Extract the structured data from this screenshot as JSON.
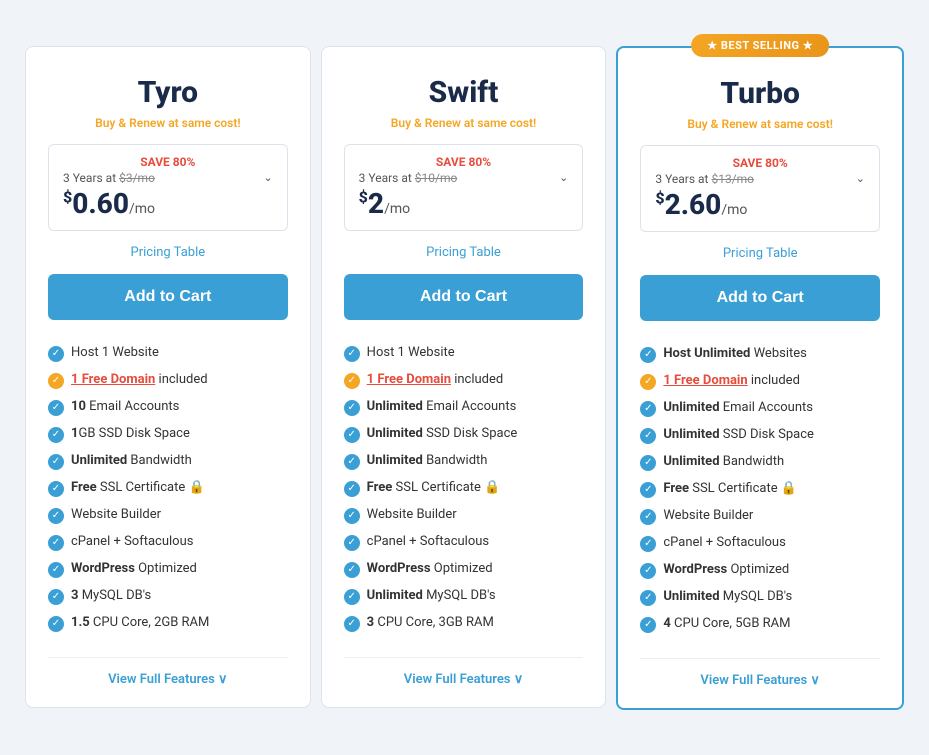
{
  "plans": [
    {
      "id": "tyro",
      "name": "Tyro",
      "tagline": "Buy & Renew at same cost!",
      "featured": false,
      "save_label": "SAVE 80%",
      "years_text": "3 Years at",
      "original_price": "$3/mo",
      "current_price_symbol": "$",
      "current_price_main": "0.60",
      "current_price_suffix": "/mo",
      "pricing_table_label": "Pricing Table",
      "add_to_cart_label": "Add to Cart",
      "features": [
        {
          "icon": "blue",
          "text": "Host 1 Website",
          "bold": ""
        },
        {
          "icon": "orange",
          "text": " Free Domain included",
          "bold": "1",
          "red_link": "1 Free Domain"
        },
        {
          "icon": "blue",
          "text": " Email Accounts",
          "bold": "10",
          "prefix_bold": "10"
        },
        {
          "icon": "blue",
          "text": "GB SSD Disk Space",
          "bold": "1",
          "prefix_bold": "1"
        },
        {
          "icon": "blue",
          "text": " Bandwidth",
          "bold": "Unlimited",
          "prefix_bold": "Unlimited"
        },
        {
          "icon": "blue",
          "text": " SSL Certificate 🔒",
          "bold": "Free",
          "prefix_bold": "Free",
          "ssl": true
        },
        {
          "icon": "blue",
          "text": "Website Builder",
          "bold": ""
        },
        {
          "icon": "blue",
          "text": "cPanel + Softaculous",
          "bold": ""
        },
        {
          "icon": "blue",
          "text": " Optimized",
          "bold": "WordPress",
          "prefix_bold": "WordPress"
        },
        {
          "icon": "blue",
          "text": " MySQL DB's",
          "bold": "3",
          "prefix_bold": "3"
        },
        {
          "icon": "blue",
          "text": " CPU Core, 2GB RAM",
          "bold": "1.5",
          "prefix_bold": "1.5"
        }
      ],
      "view_full_features_label": "View Full Features ∨"
    },
    {
      "id": "swift",
      "name": "Swift",
      "tagline": "Buy & Renew at same cost!",
      "featured": false,
      "save_label": "SAVE 80%",
      "years_text": "3 Years at",
      "original_price": "$10/mo",
      "current_price_symbol": "$",
      "current_price_main": "2",
      "current_price_suffix": "/mo",
      "pricing_table_label": "Pricing Table",
      "add_to_cart_label": "Add to Cart",
      "features": [
        {
          "icon": "blue",
          "text": "Host 1 Website",
          "bold": ""
        },
        {
          "icon": "orange",
          "text": " Free Domain included",
          "bold": "1",
          "red_link": "1 Free Domain"
        },
        {
          "icon": "blue",
          "text": " Email Accounts",
          "bold": "Unlimited",
          "prefix_bold": "Unlimited"
        },
        {
          "icon": "blue",
          "text": " SSD Disk Space",
          "bold": "Unlimited",
          "prefix_bold": "Unlimited"
        },
        {
          "icon": "blue",
          "text": " Bandwidth",
          "bold": "Unlimited",
          "prefix_bold": "Unlimited"
        },
        {
          "icon": "blue",
          "text": " SSL Certificate 🔒",
          "bold": "Free",
          "prefix_bold": "Free",
          "ssl": true
        },
        {
          "icon": "blue",
          "text": "Website Builder",
          "bold": ""
        },
        {
          "icon": "blue",
          "text": "cPanel + Softaculous",
          "bold": ""
        },
        {
          "icon": "blue",
          "text": " Optimized",
          "bold": "WordPress",
          "prefix_bold": "WordPress"
        },
        {
          "icon": "blue",
          "text": " MySQL DB's",
          "bold": "Unlimited",
          "prefix_bold": "Unlimited"
        },
        {
          "icon": "blue",
          "text": " CPU Core, 3GB RAM",
          "bold": "3",
          "prefix_bold": "3"
        }
      ],
      "view_full_features_label": "View Full Features ∨"
    },
    {
      "id": "turbo",
      "name": "Turbo",
      "tagline": "Buy & Renew at same cost!",
      "featured": true,
      "best_selling_label": "★ BEST SELLING ★",
      "save_label": "SAVE 80%",
      "years_text": "3 Years at",
      "original_price": "$13/mo",
      "current_price_symbol": "$",
      "current_price_main": "2.60",
      "current_price_suffix": "/mo",
      "pricing_table_label": "Pricing Table",
      "add_to_cart_label": "Add to Cart",
      "features": [
        {
          "icon": "blue",
          "text": " Websites",
          "bold": "Host Unlimited",
          "prefix_bold": "Host Unlimited"
        },
        {
          "icon": "orange",
          "text": " Free Domain included",
          "bold": "1",
          "red_link": "1 Free Domain"
        },
        {
          "icon": "blue",
          "text": " Email Accounts",
          "bold": "Unlimited",
          "prefix_bold": "Unlimited"
        },
        {
          "icon": "blue",
          "text": " SSD Disk Space",
          "bold": "Unlimited",
          "prefix_bold": "Unlimited"
        },
        {
          "icon": "blue",
          "text": " Bandwidth",
          "bold": "Unlimited",
          "prefix_bold": "Unlimited"
        },
        {
          "icon": "blue",
          "text": " SSL Certificate 🔒",
          "bold": "Free",
          "prefix_bold": "Free",
          "ssl": true
        },
        {
          "icon": "blue",
          "text": "Website Builder",
          "bold": ""
        },
        {
          "icon": "blue",
          "text": "cPanel + Softaculous",
          "bold": ""
        },
        {
          "icon": "blue",
          "text": " Optimized",
          "bold": "WordPress",
          "prefix_bold": "WordPress"
        },
        {
          "icon": "blue",
          "text": " MySQL DB's",
          "bold": "Unlimited",
          "prefix_bold": "Unlimited"
        },
        {
          "icon": "blue",
          "text": " CPU Core, 5GB RAM",
          "bold": "4",
          "prefix_bold": "4"
        }
      ],
      "view_full_features_label": "View Full Features ∨"
    }
  ],
  "icons": {
    "checkmark": "✓",
    "chevron_down": "∨"
  }
}
